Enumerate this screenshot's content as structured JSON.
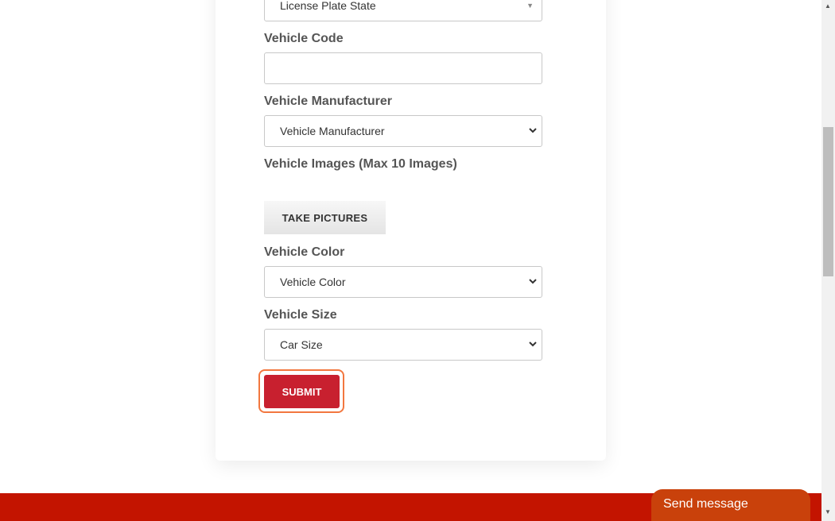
{
  "form": {
    "license_plate_state": {
      "selected": "License Plate State"
    },
    "vehicle_code": {
      "label": "Vehicle Code",
      "value": "",
      "placeholder": ""
    },
    "vehicle_manufacturer": {
      "label": "Vehicle Manufacturer",
      "selected": "Vehicle Manufacturer"
    },
    "vehicle_images": {
      "label": "Vehicle Images (Max 10 Images)",
      "button": "TAKE PICTURES"
    },
    "vehicle_color": {
      "label": "Vehicle Color",
      "selected": "Vehicle Color"
    },
    "vehicle_size": {
      "label": "Vehicle Size",
      "selected": "Car Size"
    },
    "submit_label": "SUBMIT"
  },
  "chat": {
    "label": "Send message"
  },
  "icons": {
    "chevron": "⌄",
    "triangle_down": "▼",
    "triangle_up": "▲"
  },
  "colors": {
    "submit": "#c8202f",
    "focus_ring": "#f2773f",
    "footer": "#c31400",
    "chat": "#c9410b"
  }
}
